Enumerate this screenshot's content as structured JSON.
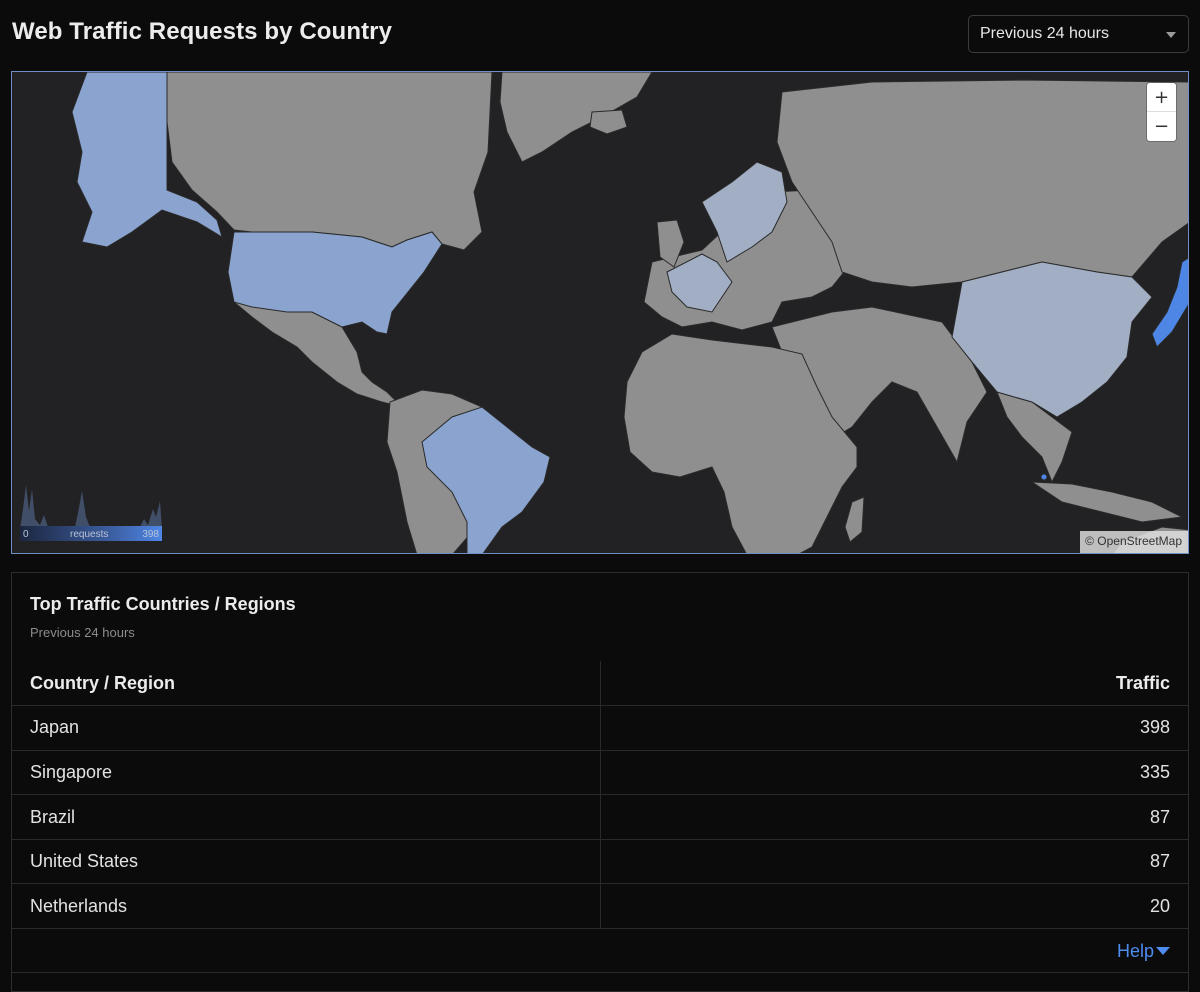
{
  "header": {
    "title": "Web Traffic Requests by Country",
    "range_selected": "Previous 24 hours"
  },
  "map": {
    "zoom_in_label": "+",
    "zoom_out_label": "−",
    "attribution": "© OpenStreetMap",
    "legend": {
      "min": "0",
      "max": "398",
      "label": "requests"
    },
    "colors": {
      "ocean": "#222224",
      "land": "#8f8f8f",
      "highlight_high": "#4e86e6",
      "highlight_mid": "#8aa4cf",
      "highlight_low": "#a2aec4"
    }
  },
  "panel": {
    "title": "Top Traffic Countries / Regions",
    "subtitle": "Previous 24 hours",
    "columns": [
      "Country / Region",
      "Traffic"
    ],
    "rows": [
      {
        "country": "Japan",
        "traffic": "398"
      },
      {
        "country": "Singapore",
        "traffic": "335"
      },
      {
        "country": "Brazil",
        "traffic": "87"
      },
      {
        "country": "United States",
        "traffic": "87"
      },
      {
        "country": "Netherlands",
        "traffic": "20"
      }
    ],
    "help_label": "Help"
  }
}
